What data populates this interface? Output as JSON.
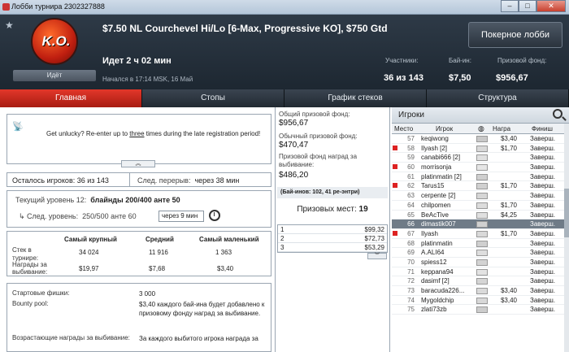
{
  "window": {
    "title": "Лобби турнира 2302327888",
    "minimize": "–",
    "maximize": "□",
    "close": "✕"
  },
  "header": {
    "logo_text": "K.O.",
    "status": "Идёт",
    "tournament_name": "$7.50 NL Courchevel Hi/Lo [6-Max, Progressive KO], $750 Gtd",
    "lobby_button": "Покерное лобби",
    "running": "Идет 2 ч 02 мин",
    "started": "Начался в 17:14 MSK, 16 Май",
    "stats": [
      {
        "label": "Участники:",
        "value": "36 из 143"
      },
      {
        "label": "Бай-ин:",
        "value": "$7,50"
      },
      {
        "label": "Призовой фонд:",
        "value": "$956,67"
      }
    ]
  },
  "tabs": [
    "Главная",
    "Стопы",
    "График стеков",
    "Структура"
  ],
  "notice": {
    "before": "Get unlucky? Re-enter up to ",
    "link": "three",
    "after": " times during the late registration period!"
  },
  "summary": {
    "players_label": "Осталось игроков:",
    "players_value": "36 из 143",
    "break_label": "След. перерыв:",
    "break_value": "через 38 мин"
  },
  "level": {
    "current_label": "Текущий уровень 12:",
    "current_value": "блайнды 200/400 анте 50",
    "next_label": "След. уровень:",
    "next_value": "250/500 анте 60",
    "timer": "через 9 мин"
  },
  "stacks": {
    "headers": [
      "Самый крупный",
      "Средний",
      "Самый маленький"
    ],
    "stack_label": "Стек в турнире:",
    "stack_values": [
      "34 024",
      "11 916",
      "1 363"
    ],
    "bounty_label": "Награды за выбивание:",
    "bounty_values": [
      "$19,97",
      "$7,68",
      "$3,40"
    ]
  },
  "info": {
    "chips_label": "Стартовые фишки:",
    "chips_value": "3 000",
    "bounty_label": "Bounty pool:",
    "bounty_value": "$3,40 каждого бай-ина будет добавлено к призовому фонду наград за выбивание.",
    "growing_label": "Возрастающие награды за выбивание:",
    "growing_value": "За каждого выбитого игрока награда за"
  },
  "prize": {
    "total_label": "Общий призовой фонд:",
    "total_value": "$956,67",
    "regular_label": "Обычный призовой фонд:",
    "regular_value": "$470,47",
    "bounty_label": "Призовой фонд наград за выбивание:",
    "bounty_value": "$486,20",
    "buyins": "(Бай-инов: 102, 41 ре-энтри)",
    "places_label": "Призовых мест:",
    "places_value": "19",
    "payouts": [
      {
        "place": "1",
        "amount": "$99,32"
      },
      {
        "place": "2",
        "amount": "$72,73"
      },
      {
        "place": "3",
        "amount": "$53,29"
      }
    ]
  },
  "players_panel": {
    "title": "Игроки",
    "columns": [
      "Место",
      "Игрок",
      "Награ",
      "Финиш"
    ],
    "rows": [
      {
        "place": "57",
        "name": "keqiwong",
        "bounty": "$3,40",
        "finish": "Заверш.",
        "ko": false,
        "flag": "#c8c8c8",
        "sel": false
      },
      {
        "place": "58",
        "name": "Ilyash [2]",
        "bounty": "$1,70",
        "finish": "Заверш.",
        "ko": true,
        "flag": "#d9d9d9",
        "sel": false
      },
      {
        "place": "59",
        "name": "canabi666 [2]",
        "bounty": "",
        "finish": "Заверш.",
        "ko": false,
        "flag": "#e0e0e0",
        "sel": false
      },
      {
        "place": "60",
        "name": "morrisonja",
        "bounty": "",
        "finish": "Заверш.",
        "ko": true,
        "flag": "#e6e6e6",
        "sel": false
      },
      {
        "place": "61",
        "name": "platinmatin [2]",
        "bounty": "",
        "finish": "Заверш.",
        "ko": false,
        "flag": "#cfcfcf",
        "sel": false
      },
      {
        "place": "62",
        "name": "Tarus15",
        "bounty": "$1,70",
        "finish": "Заверш.",
        "ko": true,
        "flag": "#d0d0d0",
        "sel": false
      },
      {
        "place": "63",
        "name": "cerpente [2]",
        "bounty": "",
        "finish": "Заверш.",
        "ko": false,
        "flag": "#d6d6d6",
        "sel": false
      },
      {
        "place": "64",
        "name": "chilpomen",
        "bounty": "$1,70",
        "finish": "Заверш.",
        "ko": false,
        "flag": "#dcdcdc",
        "sel": false
      },
      {
        "place": "65",
        "name": "BeAcTive",
        "bounty": "$4,25",
        "finish": "Заверш.",
        "ko": false,
        "flag": "#e0e0e0",
        "sel": false
      },
      {
        "place": "66",
        "name": "dimastik007",
        "bounty": "",
        "finish": "Заверш.",
        "ko": false,
        "flag": "#d0d0d0",
        "sel": true
      },
      {
        "place": "67",
        "name": "Ilyash",
        "bounty": "$1,70",
        "finish": "Заверш.",
        "ko": true,
        "flag": "#d9d9d9",
        "sel": false
      },
      {
        "place": "68",
        "name": "platinmatin",
        "bounty": "",
        "finish": "Заверш.",
        "ko": false,
        "flag": "#cfcfcf",
        "sel": false
      },
      {
        "place": "69",
        "name": "A.ALI64",
        "bounty": "",
        "finish": "Заверш.",
        "ko": false,
        "flag": "#dedede",
        "sel": false
      },
      {
        "place": "70",
        "name": "spiess12",
        "bounty": "",
        "finish": "Заверш.",
        "ko": false,
        "flag": "#d3d3d3",
        "sel": false
      },
      {
        "place": "71",
        "name": "keppana94",
        "bounty": "",
        "finish": "Заверш.",
        "ko": false,
        "flag": "#e3e3e3",
        "sel": false
      },
      {
        "place": "72",
        "name": "dasimf [2]",
        "bounty": "",
        "finish": "Заверш.",
        "ko": false,
        "flag": "#d5d5d5",
        "sel": false
      },
      {
        "place": "73",
        "name": "baracuda226...",
        "bounty": "$3,40",
        "finish": "Заверш.",
        "ko": false,
        "flag": "#dadada",
        "sel": false
      },
      {
        "place": "74",
        "name": "Mygoldchip",
        "bounty": "$3,40",
        "finish": "Заверш.",
        "ko": false,
        "flag": "#d8d8d8",
        "sel": false
      },
      {
        "place": "75",
        "name": "zlati73zb",
        "bounty": "",
        "finish": "Заверш.",
        "ko": false,
        "flag": "#cccccc",
        "sel": false
      }
    ]
  },
  "colors": {
    "accent": "#c8261a",
    "header_bg": "#263140",
    "selected_row": "#6f7b87"
  }
}
